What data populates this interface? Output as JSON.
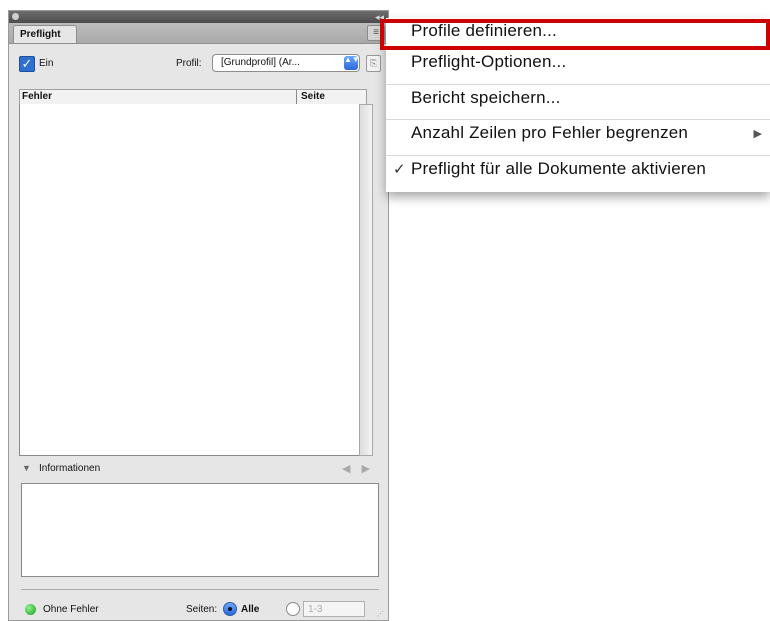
{
  "panel": {
    "collapse_glyph": "◂◂",
    "tab_label": "Preflight",
    "menu_glyph": "≡",
    "ein_label": "Ein",
    "checkbox_glyph": "✓",
    "profil_label": "Profil:",
    "profil_value": "[Grundprofil] (Ar...",
    "profil_arrows": "▲▼",
    "profil_icon_glyph": "⎘",
    "col_fehler": "Fehler",
    "col_seite": "Seite",
    "info_label": "Informationen",
    "info_arrows": "◀ ▶",
    "info_triangle": "▼",
    "status_text": "Ohne Fehler",
    "seiten_label": "Seiten:",
    "alle_label": "Alle",
    "range_value": "1-3",
    "grip_glyph": "⋰"
  },
  "menu": {
    "items": [
      {
        "label": "Profile definieren..."
      },
      {
        "label": "Preflight-Optionen..."
      },
      {
        "label": "Bericht speichern..."
      },
      {
        "label": "Anzahl Zeilen pro Fehler begrenzen",
        "submenu_glyph": "▶"
      },
      {
        "label": "Preflight für alle Dokumente aktivieren",
        "check_glyph": "✓"
      }
    ]
  },
  "colors": {
    "highlight": "#cc0000",
    "accent": "#2b68d6",
    "status_ok": "#1b9c1b"
  }
}
